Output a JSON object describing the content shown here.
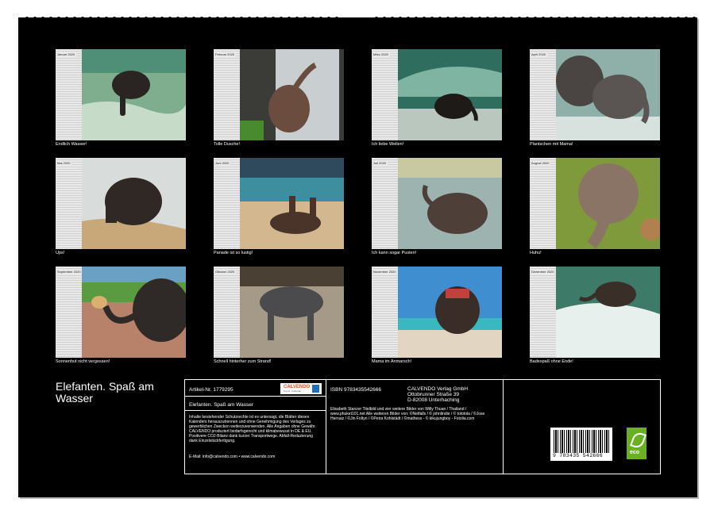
{
  "title": "Elefanten. Spaß am Wasser",
  "months": [
    {
      "name": "Januar 2020",
      "caption": "Endlich Wasser!"
    },
    {
      "name": "Februar 2020",
      "caption": "Tolle Dusche!"
    },
    {
      "name": "März 2020",
      "caption": "Ich liebe Wellen!"
    },
    {
      "name": "April 2020",
      "caption": "Plantschen mit Mama!"
    },
    {
      "name": "Mai 2020",
      "caption": "Ups!"
    },
    {
      "name": "Juni 2020",
      "caption": "Panade ist so lustig!"
    },
    {
      "name": "Juli 2020",
      "caption": "Ich kann sogar Pusten!"
    },
    {
      "name": "August 2020",
      "caption": "Huhu!"
    },
    {
      "name": "September 2020",
      "caption": "Sonnenhut nicht vergessen!"
    },
    {
      "name": "Oktober 2020",
      "caption": "Schnell hinterher zum Strand!"
    },
    {
      "name": "November 2020",
      "caption": "Mama im Anmarsch!"
    },
    {
      "name": "Dezember 2020",
      "caption": "Badespaß ohne Ende!"
    }
  ],
  "info": {
    "artikel": "Artikel-Nr. 1779295",
    "logo_text": "CALVENDO",
    "logo_sub": "Kunst · Kalender",
    "title": "Elefanten. Spaß am Wasser",
    "legal": "Inhalte bestehender Schutzrechte ist es untersagt, die Blätter dieses Kalenders herauszutrennen und ohne Genehmigung des Verlages zu gewerblichen Zwecken weiterzuverwenden. Alle Angaben ohne Gewähr. CALVENDO produziert bedarfsgerecht und klimabewusst in DE & EU. Positivere CO2-Bilanz dank kurzer Transportwege. Abfall-Reduzierung dank Einzelstückfertigung.",
    "contact": "E-Mail: info@calvendo.com • www.calvendo.com",
    "isbn": "ISBN 9783435542666",
    "publisher": [
      "CALVENDO Verlag GmbH",
      "Ottobrunner Straße 39",
      "D-82008 Unterhaching"
    ],
    "credits": "Elisabeth Stanzer Titelbild und vier weitere Bilder von Willy Thuan / Thailand / www.phuket101.net Alle weiteren Bilder von: ©Netfalls / © johnlindie / © tolotola / ©Jose Hernaiz / ©Jin Foltyn / ©Petra Kohlstädt / ©mathess - © kikujungboy - Fotolia.com",
    "barcode": "9 783435 542666",
    "eco_label": "eco"
  }
}
